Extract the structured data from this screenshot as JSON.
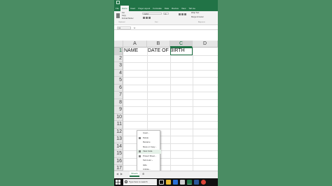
{
  "window": {
    "qa_toolbar_icons": [
      "save-icon",
      "undo-icon",
      "redo-icon"
    ]
  },
  "ribbon": {
    "tabs": [
      "File",
      "Home",
      "Insert",
      "Page Layout",
      "Formulas",
      "Data",
      "Review",
      "View",
      "Tell me"
    ],
    "active_tab": "Home",
    "clipboard": {
      "cut": "Cut",
      "copy": "Copy",
      "format_painter": "Format Painter",
      "group": "Clipboard"
    },
    "font": {
      "name": "Calibri",
      "size": "11",
      "group": "Font"
    },
    "alignment": {
      "wrap_text": "Wrap Text",
      "merge_center": "Merge & Center",
      "group": "Alignment"
    }
  },
  "formula_bar": {
    "name_box": "C1",
    "fx": "fx",
    "value": ""
  },
  "grid": {
    "columns": [
      "A",
      "B",
      "C",
      "D"
    ],
    "selected_column": "C",
    "rows": [
      "1",
      "2",
      "3",
      "4",
      "5",
      "6",
      "7",
      "8",
      "9",
      "10",
      "11",
      "12",
      "13",
      "14",
      "15",
      "16",
      "17"
    ],
    "selected_row": "1",
    "cells": {
      "A1": "NAME",
      "B1": "DATE OF BIRTH"
    }
  },
  "context_menu": {
    "items": [
      "Insert...",
      "Delete",
      "Rename",
      "Move or Copy...",
      "View Code",
      "Protect Sheet...",
      "Tab Color",
      "Hide",
      "Unhide...",
      "Select All Sheets"
    ],
    "highlighted": "View Code"
  },
  "sheet_bar": {
    "tab": "Sheet1",
    "add_icon": "plus-icon"
  },
  "taskbar": {
    "search_placeholder": "Type here to search",
    "icons": [
      "windows-start-icon",
      "search-icon",
      "task-view-icon",
      "file-explorer-icon",
      "store-icon",
      "mail-icon",
      "excel-icon",
      "word-icon",
      "chrome-icon"
    ]
  },
  "colors": {
    "desktop": "#4a8c63",
    "excel_green": "#217346"
  }
}
